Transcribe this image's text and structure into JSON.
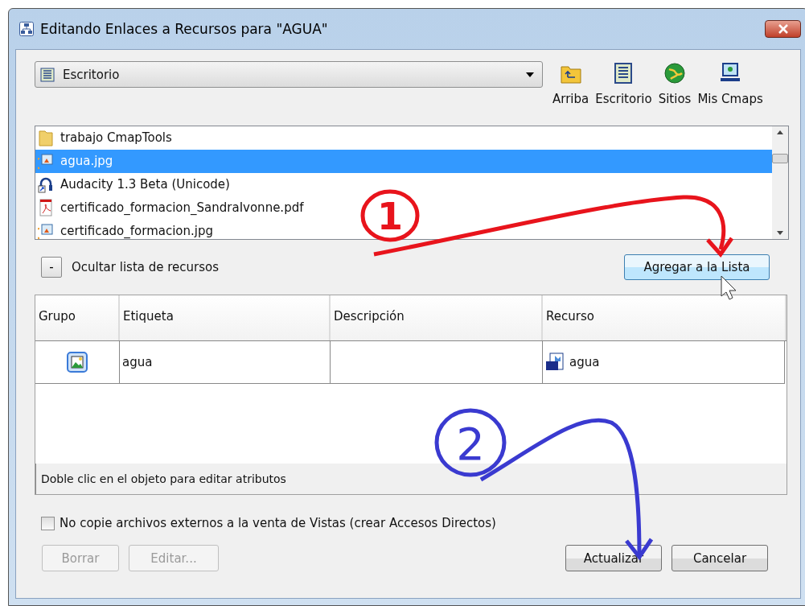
{
  "window": {
    "title": "Editando Enlaces a Recursos para \"AGUA\""
  },
  "location": {
    "value": "Escritorio"
  },
  "toolbar": [
    {
      "label": "Arriba",
      "kind": "up"
    },
    {
      "label": "Escritorio",
      "kind": "desktop"
    },
    {
      "label": "Sitios",
      "kind": "sites"
    },
    {
      "label": "Mis Cmaps",
      "kind": "mycmaps"
    }
  ],
  "files": [
    {
      "name": "trabajo CmapTools",
      "kind": "folder",
      "selected": false
    },
    {
      "name": "agua.jpg",
      "kind": "image",
      "selected": true
    },
    {
      "name": "Audacity 1.3 Beta (Unicode)",
      "kind": "shortcut",
      "selected": false
    },
    {
      "name": "certificado_formacion_SandraIvonne.pdf",
      "kind": "pdf",
      "selected": false
    },
    {
      "name": "certificado_formacion.jpg",
      "kind": "image",
      "selected": false
    }
  ],
  "toggle": {
    "symbol": "-",
    "label": "Ocultar lista de recursos"
  },
  "add_button": "Agregar a la Lista",
  "table": {
    "columns": [
      "Grupo",
      "Etiqueta",
      "Descripción",
      "Recurso"
    ],
    "rows": [
      {
        "etiqueta": "agua",
        "descripcion": "",
        "recurso": "agua"
      }
    ],
    "hint": "Doble clic en el objeto para editar atributos"
  },
  "copy_option": {
    "label": "No copie archivos externos a la venta de Vistas (crear Accesos Directos)",
    "checked": false
  },
  "buttons": [
    {
      "label": "Borrar",
      "disabled": true
    },
    {
      "label": "Editar...",
      "disabled": true
    },
    {
      "label": "Actualizar",
      "disabled": false
    },
    {
      "label": "Cancelar",
      "disabled": false
    }
  ],
  "annotations": [
    {
      "number": "1",
      "color": "#e8141c"
    },
    {
      "number": "2",
      "color": "#3a3ad0"
    }
  ]
}
